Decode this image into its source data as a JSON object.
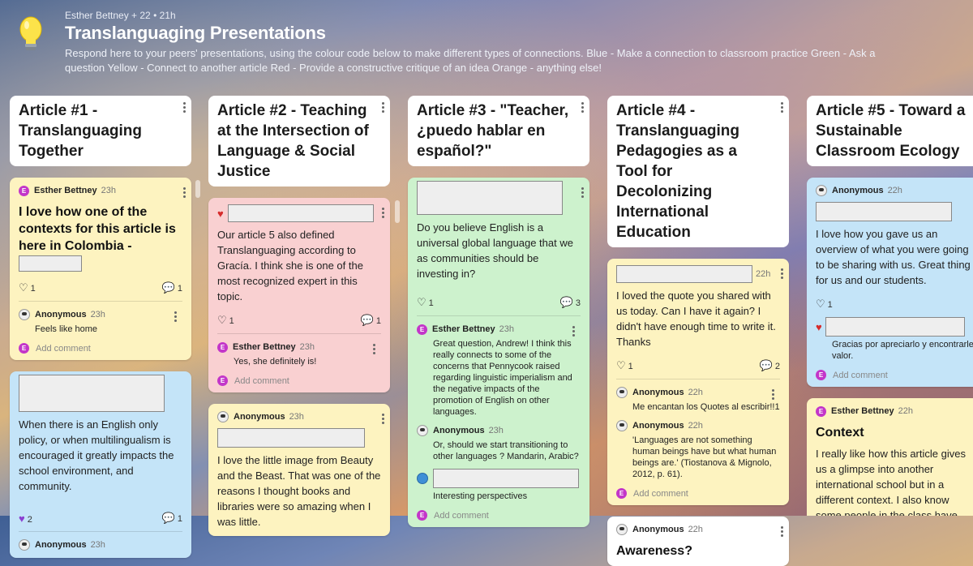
{
  "board": {
    "meta": "Esther Bettney + 22 • 21h",
    "title": "Translanguaging Presentations",
    "description": "Respond here to your peers' presentations, using the colour code below to make different types of connections. Blue - Make a connection to classroom practice Green - Ask a question Yellow - Connect to another article Red - Provide a constructive critique of an idea Orange - anything else!",
    "icon": "lightbulb-icon"
  },
  "columns": [
    {
      "title": "Article #1 - Translanguaging Together",
      "cards": [
        {
          "author": "Esther Bettney",
          "time": "23h",
          "title": "I love how one of the contexts for this article is here in Colombia -",
          "likes": "1",
          "comments_count": "1",
          "comments": [
            {
              "author": "Anonymous",
              "time": "23h",
              "text": "Feels like home"
            }
          ],
          "add_comment": "Add comment"
        },
        {
          "body": "When there is an English only policy, or when multilingualism is encouraged it greatly impacts the school environment, and community.",
          "likes": "2",
          "comments_count": "1",
          "comments": [
            {
              "author": "Anonymous",
              "time": "23h"
            }
          ]
        }
      ]
    },
    {
      "title": "Article #2 - Teaching at the Intersection of Language & Social Justice",
      "cards": [
        {
          "body": "Our article 5 also defined Translanguaging according to Gracía. I think she is one of the most recognized expert in this topic.",
          "likes": "1",
          "comments_count": "1",
          "comments": [
            {
              "author": "Esther Bettney",
              "time": "23h",
              "text": "Yes, she definitely is!"
            }
          ],
          "add_comment": "Add comment"
        },
        {
          "author": "Anonymous",
          "time": "23h",
          "body": "I love the little image from Beauty and the Beast. That was one of the reasons I thought books and libraries were so amazing when I was little."
        }
      ]
    },
    {
      "title": "Article #3 - \"Teacher, ¿puedo hablar en español?\"",
      "cards": [
        {
          "body": "Do you believe English is a universal global language that we as communities should be investing in?",
          "likes": "1",
          "comments_count": "3",
          "comments": [
            {
              "author": "Esther Bettney",
              "time": "23h",
              "text": "Great question, Andrew! I think this really connects to some of the concerns that Pennycook raised regarding linguistic imperialism and the negative impacts of the promotion of English on other languages."
            },
            {
              "author": "Anonymous",
              "time": "23h",
              "text": "Or, should we start transitioning to other languages ? Mandarin, Arabic?"
            },
            {
              "text": "Interesting perspectives"
            }
          ],
          "add_comment": "Add comment"
        }
      ]
    },
    {
      "title": "Article #4 - Translanguaging Pedagogies as a Tool for Decolonizing International Education",
      "cards": [
        {
          "time": "22h",
          "body": "I loved the quote you shared with us today. Can I have it again? I didn't have enough time to write it. Thanks",
          "likes": "1",
          "comments_count": "2",
          "comments": [
            {
              "author": "Anonymous",
              "time": "22h",
              "text": "Me encantan los Quotes al escribir!!1"
            },
            {
              "author": "Anonymous",
              "time": "22h",
              "text": "'Languages are not something human beings have but what human beings are.' (Tiostanova & Mignolo, 2012, p. 61)."
            }
          ],
          "add_comment": "Add comment"
        },
        {
          "author": "Anonymous",
          "time": "22h",
          "title": "Awareness?"
        }
      ]
    },
    {
      "title": "Article #5 - Toward a Sustainable Classroom Ecology",
      "cards": [
        {
          "author": "Anonymous",
          "time": "22h",
          "body": "I love how you gave us an overview of what you were going to be sharing with us. Great thing for us and our students.",
          "likes": "1",
          "comments": [
            {
              "text": "Gracias por apreciarlo y encontrarle valor."
            }
          ],
          "add_comment": "Add comment"
        },
        {
          "author": "Esther Bettney",
          "time": "22h",
          "title": "Context",
          "body": "I really like how this article gives us a glimpse into another international school but in a different context. I also know some people in the class have"
        }
      ]
    }
  ],
  "colors": {
    "yellow": "#fdf3c0",
    "blue": "#c4e4f8",
    "pink": "#f9d0d1",
    "green": "#cdf2cd",
    "avatar": "#c336c9"
  }
}
